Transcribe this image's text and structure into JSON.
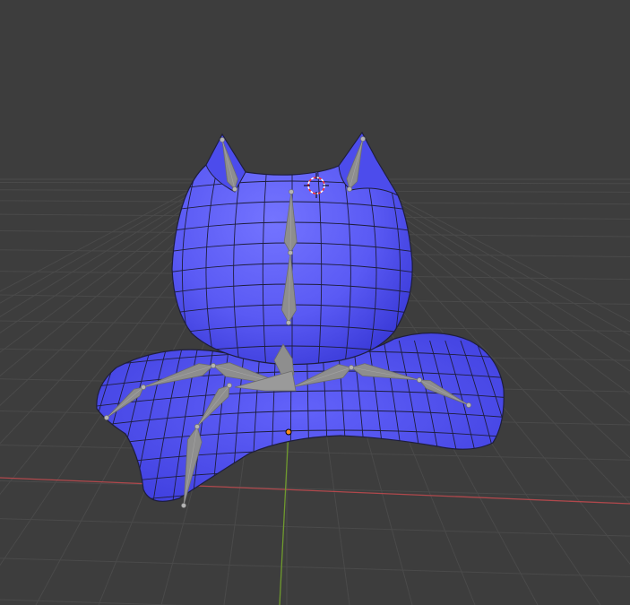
{
  "viewport": {
    "mode": "object",
    "shading": "solid",
    "background_color": "#3d3d3d",
    "grid_line_color": "#4a4a4a",
    "x_axis_color": "#b0484c",
    "y_axis_color": "#6f9a2e"
  },
  "mesh": {
    "name": "cat-blob-mesh",
    "material_color": "#5454f2",
    "highlight_color": "#7272ff",
    "shadow_color": "#3434d8",
    "wire_color": "#1e1e3c",
    "parts": [
      "head",
      "left-ear",
      "right-ear",
      "base-cushion"
    ]
  },
  "armature": {
    "bone_color": "#8e8e8e",
    "bone_edge_color": "#6c6c6c",
    "joint_color": "#b4b4b4",
    "bones": [
      "ear-left",
      "ear-right",
      "spine-upper",
      "spine-lower",
      "arm-left-upper",
      "arm-left-lower",
      "arm-right-upper",
      "arm-right-lower",
      "leg-front-upper",
      "leg-front-lower",
      "hip-left",
      "hip-right"
    ]
  },
  "cursor_3d": {
    "ring_color_a": "#ff3030",
    "ring_color_b": "#ffffff"
  },
  "origin_point": {
    "color": "#ff8c1a"
  }
}
